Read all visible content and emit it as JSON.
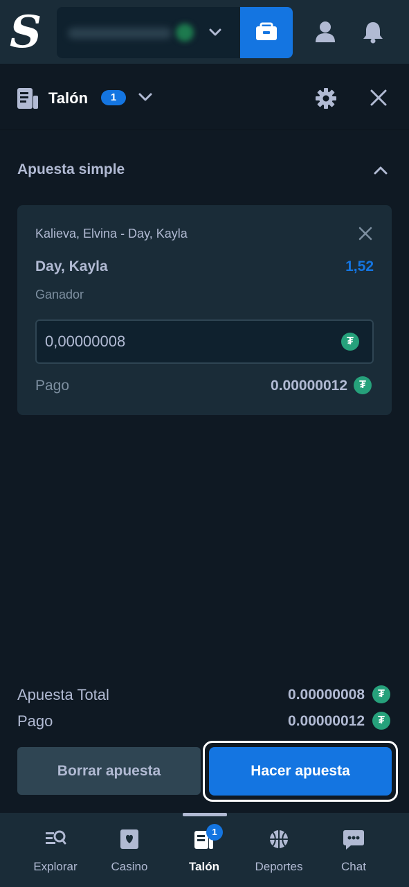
{
  "header": {
    "logo_letter": "S",
    "balance_hidden": "",
    "wallet_icon": "wallet-icon",
    "profile_icon": "user-icon",
    "notifications_icon": "bell-icon"
  },
  "betslip": {
    "title": "Talón",
    "count": "1",
    "section_title": "Apuesta simple",
    "bet": {
      "event": "Kalieva, Elvina - Day, Kayla",
      "selection": "Day, Kayla",
      "odds": "1,52",
      "market": "Ganador",
      "stake": "0,00000008",
      "payout_label": "Pago",
      "payout_value": "0.00000012",
      "currency_icon": "tether-icon",
      "currency_glyph": "₮"
    },
    "summary": {
      "total_label": "Apuesta Total",
      "total_value": "0.00000008",
      "payout_label": "Pago",
      "payout_value": "0.00000012"
    },
    "clear_button": "Borrar apuesta",
    "place_button": "Hacer apuesta"
  },
  "bottom_nav": {
    "items": [
      {
        "label": "Explorar",
        "icon": "explore-icon"
      },
      {
        "label": "Casino",
        "icon": "cards-icon"
      },
      {
        "label": "Talón",
        "icon": "betslip-icon",
        "badge": "1",
        "active": true
      },
      {
        "label": "Deportes",
        "icon": "basketball-icon"
      },
      {
        "label": "Chat",
        "icon": "chat-icon"
      }
    ]
  },
  "colors": {
    "background": "#0f1923",
    "surface": "#1a2c38",
    "accent": "#1475e1",
    "tether": "#26a17b"
  }
}
